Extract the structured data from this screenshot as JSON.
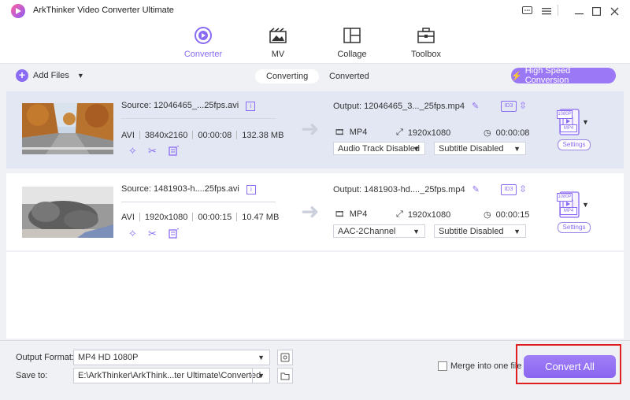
{
  "window": {
    "title": "ArkThinker Video Converter Ultimate"
  },
  "nav": [
    {
      "label": "Converter",
      "icon": "converter-icon",
      "active": true
    },
    {
      "label": "MV",
      "icon": "mv-icon"
    },
    {
      "label": "Collage",
      "icon": "collage-icon"
    },
    {
      "label": "Toolbox",
      "icon": "toolbox-icon"
    }
  ],
  "toolbar": {
    "add_files": "Add Files",
    "tabs": [
      "Converting",
      "Converted"
    ],
    "high_speed": "High Speed Conversion"
  },
  "files": [
    {
      "source": "Source: 12046465_...25fps.avi",
      "format": "AVI",
      "resolution": "3840x2160",
      "duration": "00:00:08",
      "size": "132.38 MB",
      "output": "Output: 12046465_3..._25fps.mp4",
      "out_format": "MP4",
      "out_resolution": "1920x1080",
      "out_duration": "00:00:08",
      "audio": "Audio Track Disabled",
      "subtitle": "Subtitle Disabled",
      "fmt_badge": "1080P",
      "fmt_label": "MP4",
      "settings": "Settings",
      "id3": "ID3"
    },
    {
      "source": "Source: 1481903-h....25fps.avi",
      "format": "AVI",
      "resolution": "1920x1080",
      "duration": "00:00:15",
      "size": "10.47 MB",
      "output": "Output: 1481903-hd...._25fps.mp4",
      "out_format": "MP4",
      "out_resolution": "1920x1080",
      "out_duration": "00:00:15",
      "audio": "AAC-2Channel",
      "subtitle": "Subtitle Disabled",
      "fmt_badge": "1080P",
      "fmt_label": "MP4",
      "settings": "Settings",
      "id3": "ID3"
    }
  ],
  "bottom": {
    "output_format_label": "Output Format:",
    "output_format_value": "MP4 HD 1080P",
    "save_to_label": "Save to:",
    "save_to_value": "E:\\ArkThinker\\ArkThink...ter Ultimate\\Converted",
    "merge_label": "Merge into one file",
    "merge_checked": false,
    "convert_all": "Convert All"
  },
  "colors": {
    "accent": "#8a6bf3",
    "highlight": "#e02020"
  }
}
